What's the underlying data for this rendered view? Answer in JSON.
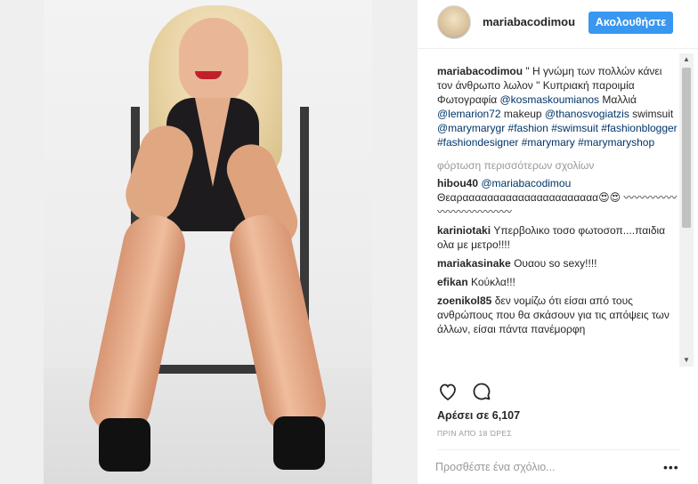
{
  "post": {
    "username": "mariabacodimou",
    "follow_label": "Ακολουθήστε",
    "caption": {
      "user": "mariabacodimou",
      "text": " \" Η γνώμη των πολλών κάνει τον άνθρωπο λωλον \" Κυπριακή παροιμία Φωτογραφία ",
      "tag1": "@kosmaskoumianos",
      "t2": " Μαλλιά ",
      "tag2": "@lemarion72",
      "t3": " makeup ",
      "tag3": "@thanosvogiatzis",
      "t4": " swimsuit ",
      "tag4": "@marymarygr",
      "t5": " ",
      "tag5": "#fashion",
      "tag6": "#swimsuit",
      "tag7": "#fashionblogger",
      "tag8": "#fashiondesigner",
      "tag9": "#marymary",
      "tag10": "#marymaryshop"
    },
    "load_more": "φόρτωση περισσότερων σχολίων",
    "comments": [
      {
        "user": "hibou40",
        "mention": "@mariabacodimou",
        "text": " Θεαραααααααααααααααααααααα😍😍 〰〰〰〰〰〰〰〰〰〰〰〰"
      },
      {
        "user": "kariniotaki",
        "mention": "",
        "text": " Υπερβολικο τοσο φωτοσοπ....παιδια ολα με μετρο!!!!"
      },
      {
        "user": "mariakasinake",
        "mention": "",
        "text": " Ουαου so sexy!!!!"
      },
      {
        "user": "efikan",
        "mention": "",
        "text": " Κούκλα!!!"
      },
      {
        "user": "zoenikol85",
        "mention": "",
        "text": " δεν νομίζω ότι είσαι από τους ανθρώπους που θα σκάσουν για τις απόψεις των άλλων, είσαι πάντα πανέμορφη"
      }
    ],
    "likes": "Αρέσει σε 6,107",
    "time": "ΠΡΙΝ ΑΠΌ 18 ΏΡΕΣ",
    "add_comment_placeholder": "Προσθέστε ένα σχόλιο...",
    "more_options": "•••"
  },
  "icons": {
    "heart": "heart-icon",
    "comment": "comment-bubble-icon"
  },
  "colors": {
    "follow_button": "#3897f0",
    "link": "#003569"
  }
}
